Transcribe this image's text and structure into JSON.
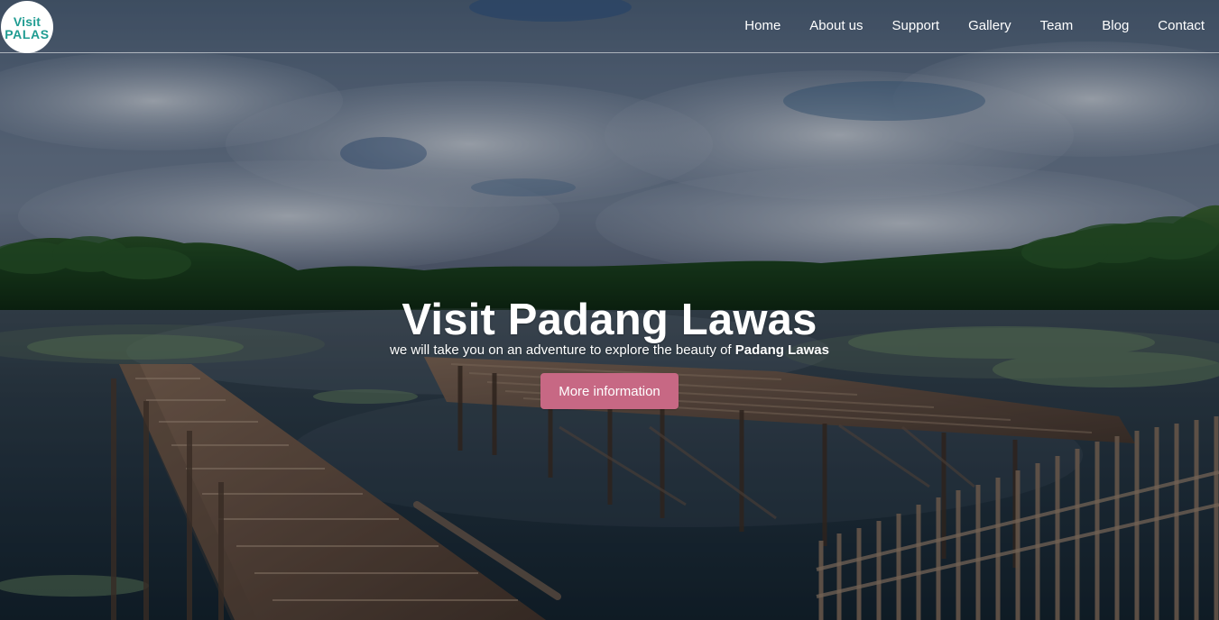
{
  "branding": {
    "logo_line_1": "Visit",
    "logo_line_2": "PALAS"
  },
  "nav": {
    "items": [
      {
        "label": "Home"
      },
      {
        "label": "About us"
      },
      {
        "label": "Support"
      },
      {
        "label": "Gallery"
      },
      {
        "label": "Team"
      },
      {
        "label": "Blog"
      },
      {
        "label": "Contact"
      }
    ]
  },
  "hero": {
    "title": "Visit Padang Lawas",
    "subtitle_prefix": "we will take you on an adventure to explore the beauty of",
    "subtitle_highlight": "Padang Lawas",
    "button_label": "More information"
  },
  "colors": {
    "accent_button": "#c76884",
    "logo_teal": "#1f9c92",
    "nav_text": "#ffffff"
  },
  "icons": {
    "logo": "circle-badge-logo"
  }
}
